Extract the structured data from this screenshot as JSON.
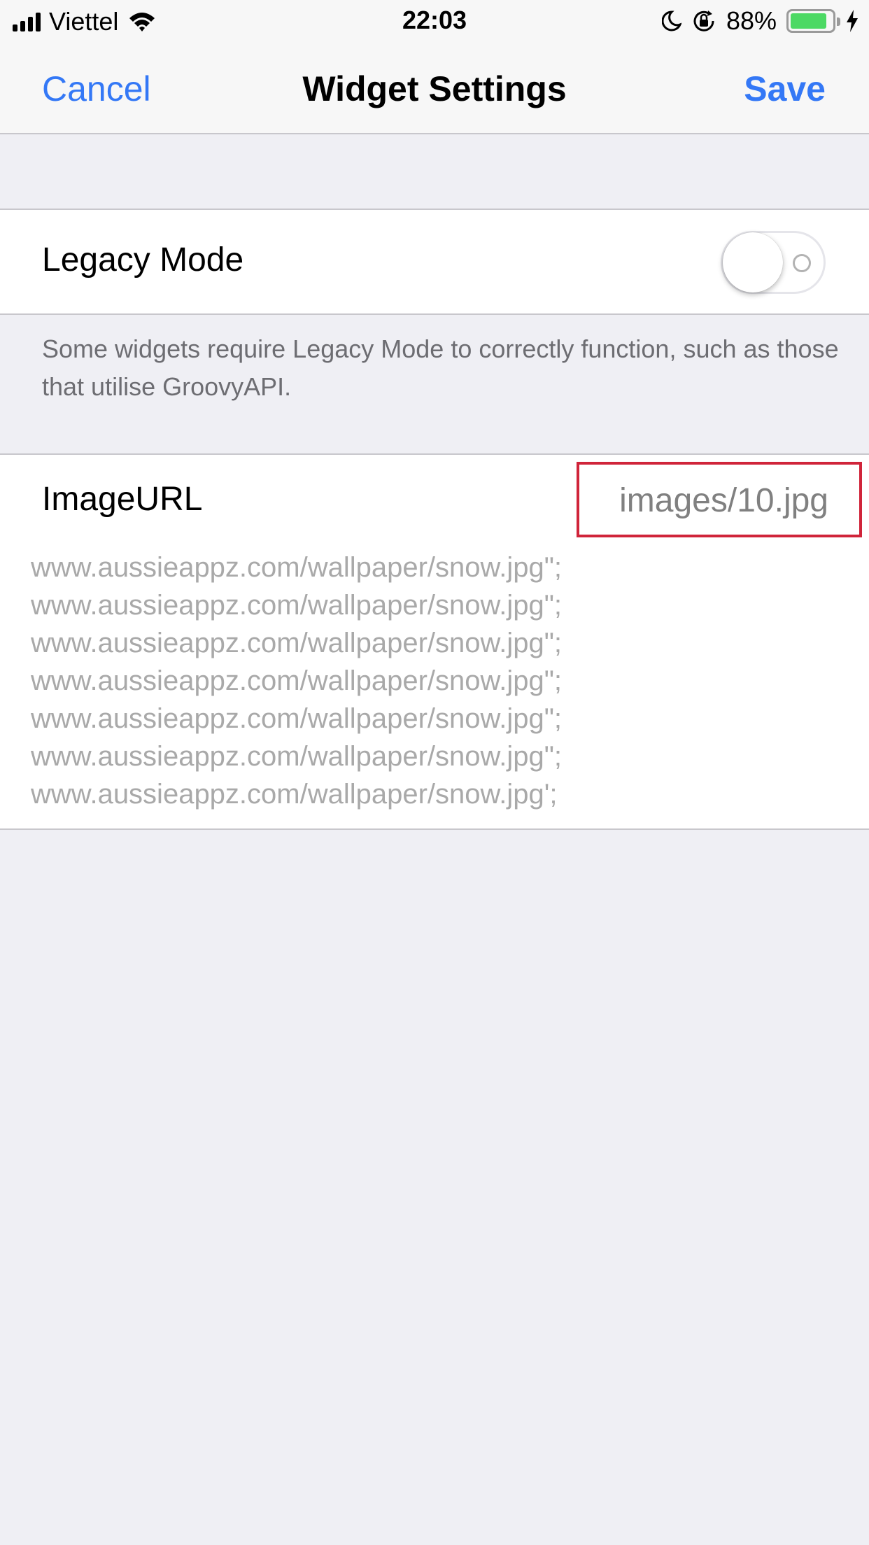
{
  "status_bar": {
    "carrier": "Viettel",
    "time": "22:03",
    "battery_percent": "88%",
    "battery_level": 0.88,
    "icons": [
      "signal-icon",
      "wifi-icon",
      "moon-icon",
      "orientation-lock-icon",
      "battery-icon",
      "charging-bolt-icon"
    ]
  },
  "nav": {
    "cancel_label": "Cancel",
    "title": "Widget Settings",
    "save_label": "Save"
  },
  "legacy": {
    "label": "Legacy Mode",
    "enabled": false,
    "note": "Some widgets require Legacy Mode to correctly function, such as those that utilise GroovyAPI."
  },
  "image_url": {
    "label": "ImageURL",
    "value": "images/10.jpg",
    "lines": [
      "www.aussieappz.com/wallpaper/snow.jpg\";",
      "www.aussieappz.com/wallpaper/snow.jpg\";",
      "www.aussieappz.com/wallpaper/snow.jpg\";",
      "www.aussieappz.com/wallpaper/snow.jpg\";",
      "www.aussieappz.com/wallpaper/snow.jpg\";",
      "www.aussieappz.com/wallpaper/snow.jpg\";",
      "www.aussieappz.com/wallpaper/snow.jpg';"
    ]
  },
  "colors": {
    "accent": "#3478f6",
    "highlight_box": "#d0243a",
    "battery_fill": "#4cd964"
  }
}
